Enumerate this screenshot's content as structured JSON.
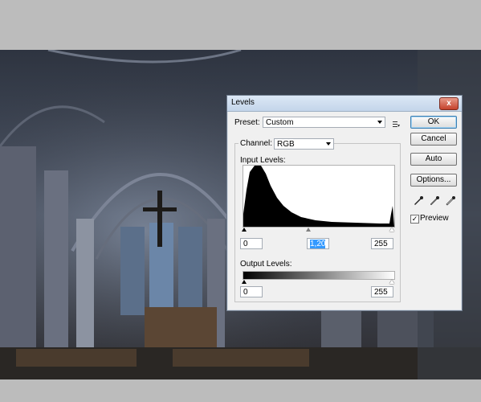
{
  "dialog": {
    "title": "Levels",
    "close_glyph": "x",
    "preset_label": "Preset:",
    "preset_value": "Custom",
    "channel_label": "Channel:",
    "channel_value": "RGB",
    "input_levels_label": "Input Levels:",
    "input_black": "0",
    "input_gamma": "1,20",
    "input_white": "255",
    "output_levels_label": "Output Levels:",
    "output_black": "0",
    "output_white": "255",
    "buttons": {
      "ok": "OK",
      "cancel": "Cancel",
      "auto": "Auto",
      "options": "Options..."
    },
    "preview_label": "Preview",
    "preview_checked": true
  },
  "colors": {
    "accent": "#3c7fb1",
    "titlebar": "#c3d5ea",
    "dialog_bg": "#f0f0f0"
  }
}
